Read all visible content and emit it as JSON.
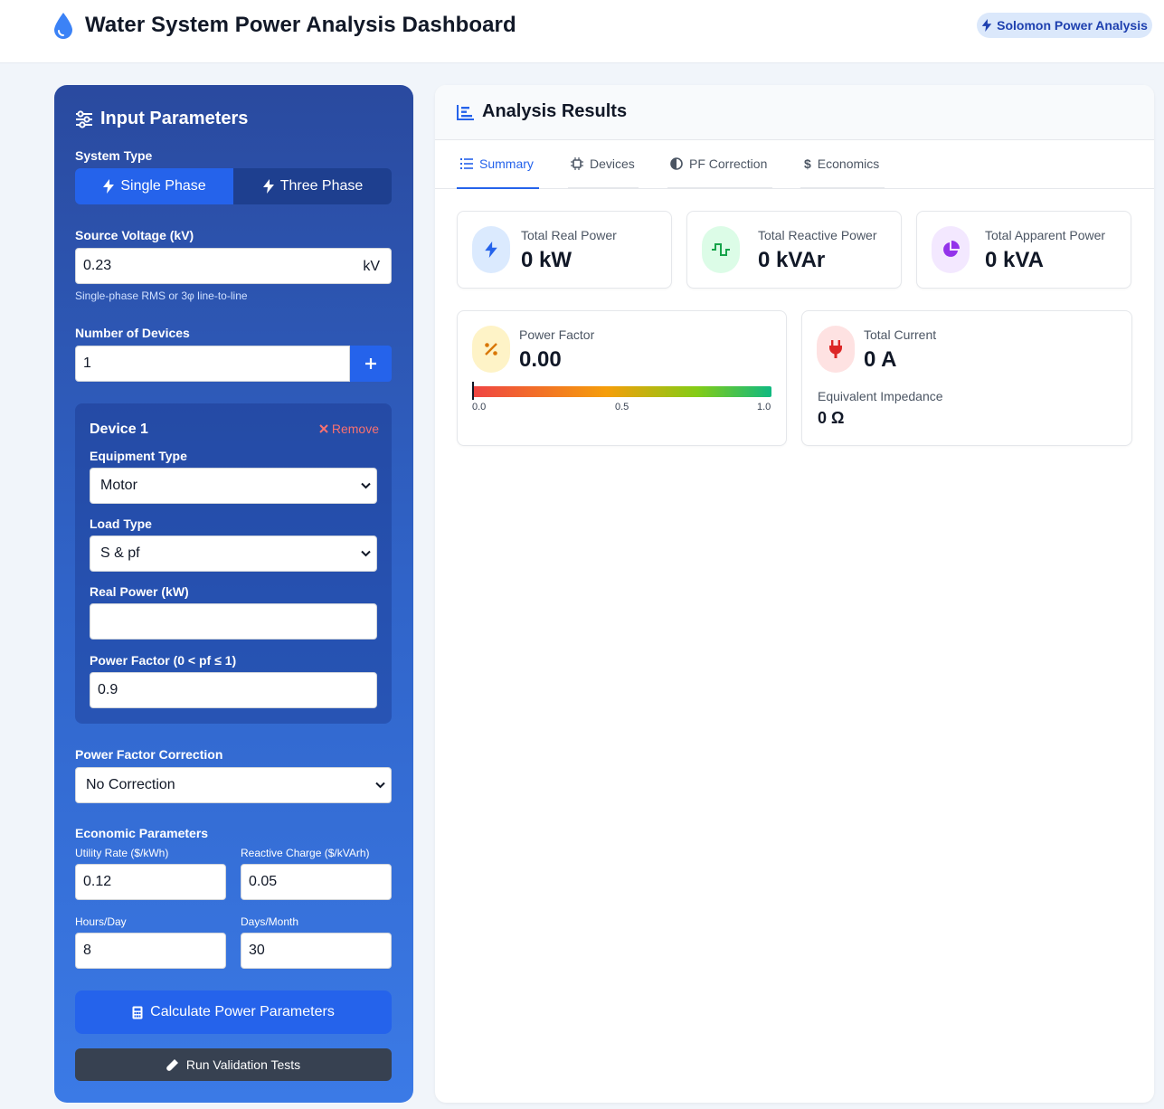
{
  "header": {
    "title": "Water System Power Analysis Dashboard",
    "brand": "Solomon Power Analysis"
  },
  "inputs": {
    "heading": "Input Parameters",
    "system_type": {
      "label": "System Type",
      "options": [
        "Single Phase",
        "Three Phase"
      ],
      "selected": "Single Phase"
    },
    "source_voltage": {
      "label": "Source Voltage (kV)",
      "value": "0.23",
      "unit": "kV",
      "hint": "Single-phase RMS or 3φ line-to-line"
    },
    "num_devices": {
      "label": "Number of Devices",
      "value": "1"
    },
    "device": {
      "title": "Device 1",
      "remove_label": "Remove",
      "equipment_type_label": "Equipment Type",
      "equipment_type_value": "Motor",
      "load_type_label": "Load Type",
      "load_type_value": "S & pf",
      "real_power_label": "Real Power (kW)",
      "real_power_value": "",
      "pf_label": "Power Factor (0 < pf ≤ 1)",
      "pf_value": "0.9"
    },
    "pf_correction": {
      "label": "Power Factor Correction",
      "value": "No Correction"
    },
    "economic": {
      "heading": "Economic Parameters",
      "utility_rate_label": "Utility Rate ($/kWh)",
      "utility_rate_value": "0.12",
      "reactive_charge_label": "Reactive Charge ($/kVArh)",
      "reactive_charge_value": "0.05",
      "hours_label": "Hours/Day",
      "hours_value": "8",
      "days_label": "Days/Month",
      "days_value": "30"
    },
    "calculate_label": "Calculate Power Parameters",
    "validate_label": "Run Validation Tests"
  },
  "results": {
    "heading": "Analysis Results",
    "tabs": [
      "Summary",
      "Devices",
      "PF Correction",
      "Economics"
    ],
    "active_tab": "Summary",
    "real_power": {
      "label": "Total Real Power",
      "value": "0 kW"
    },
    "reactive_power": {
      "label": "Total Reactive Power",
      "value": "0 kVAr"
    },
    "apparent_power": {
      "label": "Total Apparent Power",
      "value": "0 kVA"
    },
    "power_factor": {
      "label": "Power Factor",
      "value": "0.00",
      "level": 0.0,
      "ticks": [
        "0.0",
        "0.5",
        "1.0"
      ]
    },
    "current": {
      "label": "Total Current",
      "value": "0 A"
    },
    "impedance": {
      "label": "Equivalent Impedance",
      "value": "0 Ω"
    }
  },
  "colors": {
    "accent": "#2563eb",
    "panel_top": "#2a4a9f",
    "panel_bottom": "#3b7ae6",
    "remove": "#f87171"
  }
}
